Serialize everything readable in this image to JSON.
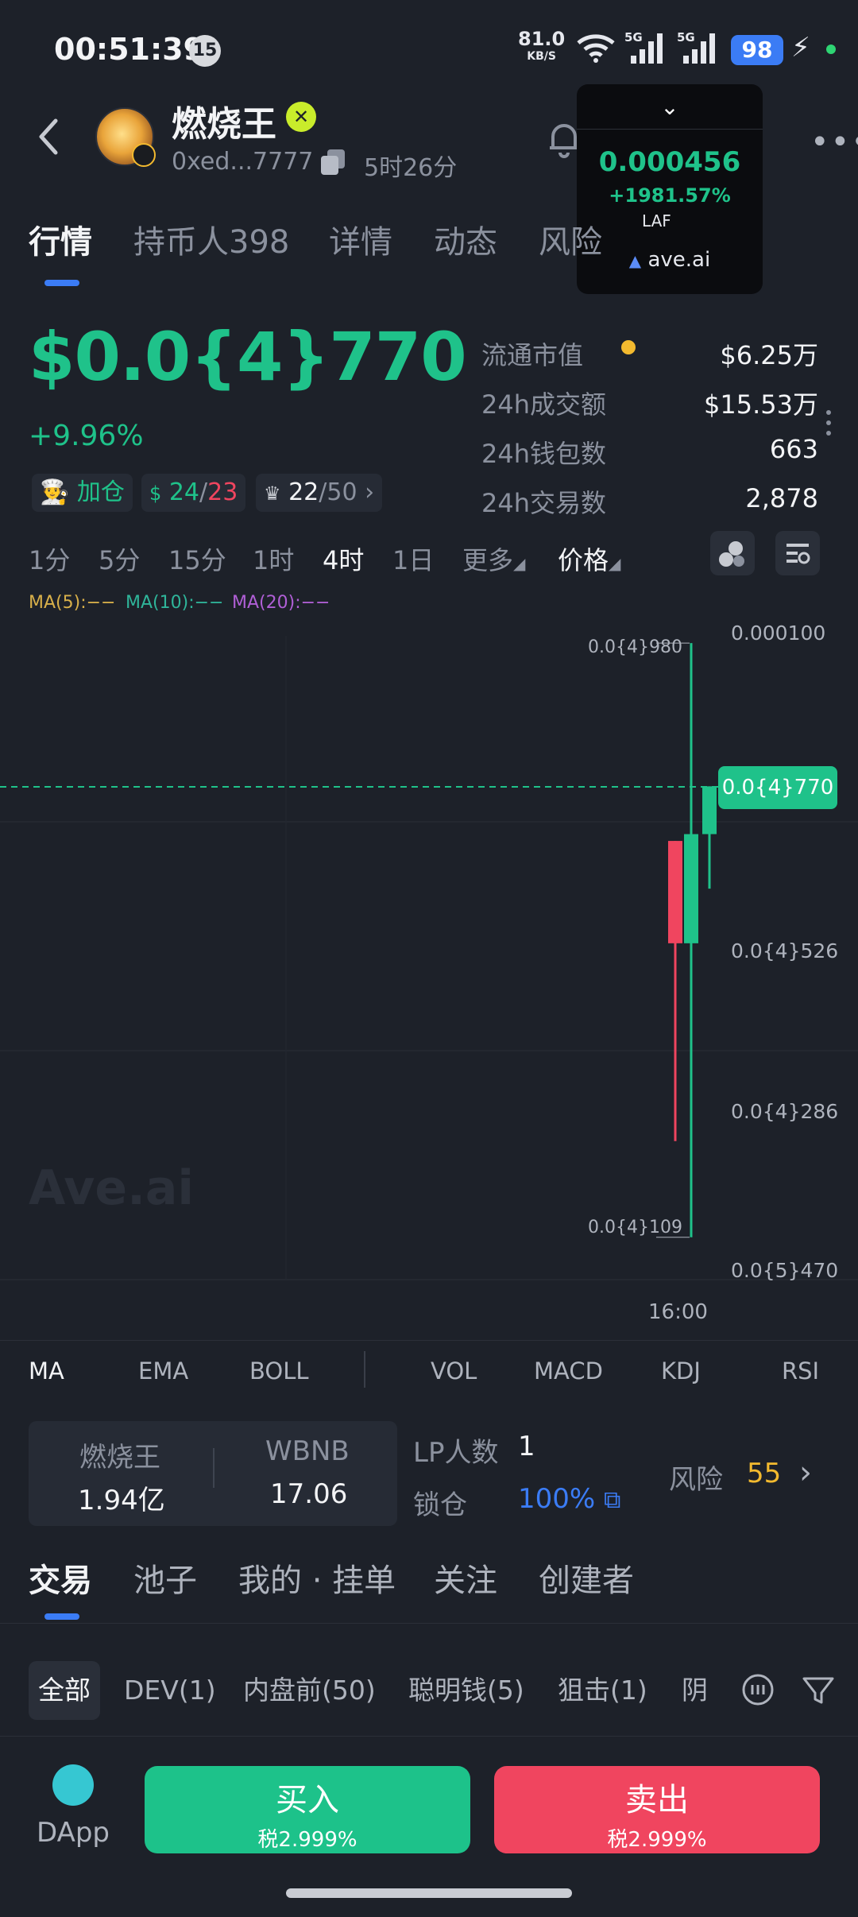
{
  "status_bar": {
    "time": "00:51:39",
    "notification_count": "15",
    "net_speed": "81.0",
    "net_speed_unit": "KB/S",
    "signal1": "5G",
    "signal2": "5G",
    "battery": "98"
  },
  "header": {
    "token_name": "燃烧王",
    "address": "0xed...7777",
    "age": "5时26分"
  },
  "float_widget": {
    "price": "0.000456",
    "change": "+1981.57%",
    "symbol": "LAF",
    "brand": "ave.ai"
  },
  "tabs": [
    "行情",
    "持币人398",
    "详情",
    "动态",
    "风险"
  ],
  "price": {
    "value": "$0.0{4}770",
    "change": "+9.96%"
  },
  "chips": {
    "add_position": "加仓",
    "c1_a": "24",
    "c1_sep": "/",
    "c1_b": "23",
    "c2_a": "22",
    "c2_b": "/50"
  },
  "stats": [
    {
      "label": "流通市值",
      "value": "$6.25万"
    },
    {
      "label": "24h成交额",
      "value": "$15.53万"
    },
    {
      "label": "24h钱包数",
      "value": "663"
    },
    {
      "label": "24h交易数",
      "value": "2,878"
    }
  ],
  "timeframes": [
    "1分",
    "5分",
    "15分",
    "1时",
    "4时",
    "1日",
    "更多",
    "价格"
  ],
  "ma_labels": [
    "MA(5):−−",
    "MA(10):−−",
    "MA(20):−−"
  ],
  "colors": {
    "up": "#1fc28a",
    "down": "#f0455f",
    "accent": "#3b7cf5",
    "warn": "#f3ba2f"
  },
  "chart_data": {
    "type": "candlestick",
    "y_ticks": [
      "0.000100",
      "0.0{4}770",
      "0.0{4}526",
      "0.0{4}286",
      "0.0{5}470"
    ],
    "current_price_label": "0.0{4}770",
    "high_annotation": "0.0{4}980",
    "low_annotation": "0.0{4}109",
    "x_tick": "16:00",
    "watermark": "Ave.ai",
    "candles": [
      {
        "open": 6.9e-05,
        "close": 5.4e-05,
        "high": 6.9e-05,
        "low": 2.5e-05,
        "dir": "down"
      },
      {
        "open": 5.4e-05,
        "close": 7e-05,
        "high": 9.8e-05,
        "low": 1.09e-05,
        "dir": "up"
      },
      {
        "open": 7e-05,
        "close": 7.7e-05,
        "high": 7.7e-05,
        "low": 6.2e-05,
        "dir": "up"
      }
    ]
  },
  "indicators": [
    "MA",
    "EMA",
    "BOLL",
    "VOL",
    "MACD",
    "KDJ",
    "RSI"
  ],
  "pool": {
    "token_a": "燃烧王",
    "amount_a": "1.94亿",
    "token_b": "WBNB",
    "amount_b": "17.06",
    "lp_label": "LP人数",
    "lp_count": "1",
    "lock_label": "锁仓",
    "lock_value": "100%",
    "risk_label": "风险",
    "risk_value": "55"
  },
  "lower_tabs": [
    "交易",
    "池子",
    "我的 · 挂单",
    "关注",
    "创建者"
  ],
  "filters": [
    "全部",
    "DEV(1)",
    "内盘前(50)",
    "聪明钱(5)",
    "狙击(1)",
    "阴"
  ],
  "bottom": {
    "dapp": "DApp",
    "buy": "买入",
    "buy_tax": "税2.999%",
    "sell": "卖出",
    "sell_tax": "税2.999%"
  }
}
